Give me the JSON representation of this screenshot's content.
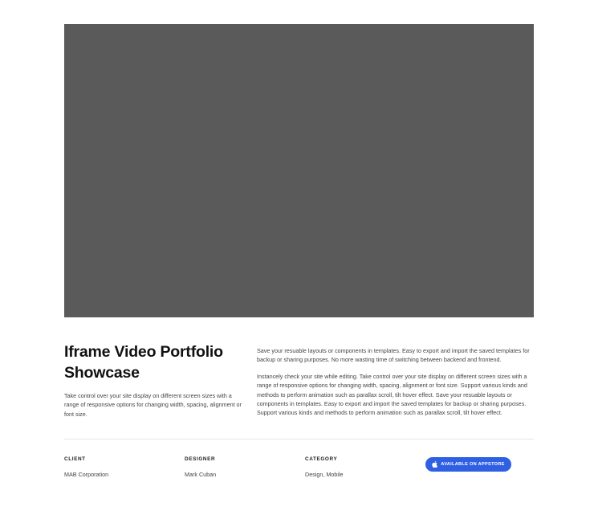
{
  "portfolio": {
    "title": "Iframe Video Portfolio Showcase",
    "intro": "Take control over your site display on different screen sizes with a range of responsive options for changing width, spacing, alignment or font size.",
    "paragraph_1": "Save your resuable layouts or components in templates. Easy to export and import the saved templates for backup or sharing purposes. No more wasting time of switching between backend and frontend.",
    "paragraph_2": "Instancely check your site while editing. Take control over your site display on different screen sizes with a range of responsive options for changing width, spacing, alignment or font size. Support various kinds and methods to perform animation such as parallax scroll, tilt hover effect. Save your resuable layouts or components in templates. Easy to export and import the saved templates for backup or sharing purposes. Support various kinds and methods to perform animation such as parallax scroll, tilt hover effect."
  },
  "meta": {
    "client_label": "CLIENT",
    "client_value": "MAB Corporation",
    "designer_label": "DESIGNER",
    "designer_value": "Mark Cuban",
    "category_label": "CATEGORY",
    "category_value": "Design, Mobile"
  },
  "appstore_button": {
    "label": "AVAILABLE ON APPSTORE",
    "icon": "apple-icon"
  },
  "colors": {
    "video_placeholder": "#5a5a5a",
    "button": "#2f5fe3",
    "divider": "#e6e6e6"
  }
}
